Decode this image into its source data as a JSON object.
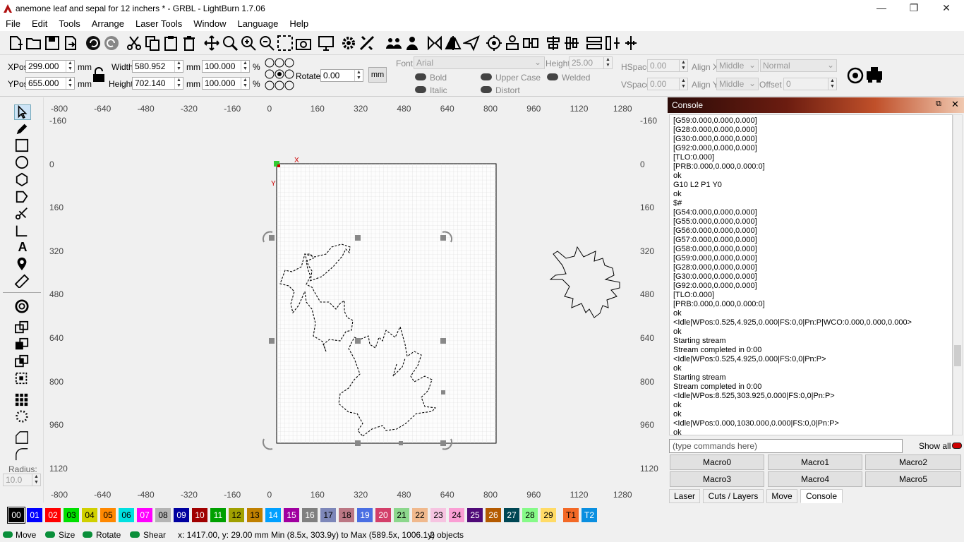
{
  "title": "anemone leaf and sepal for 12 inchers * - GRBL - LightBurn 1.7.06",
  "menu": [
    "File",
    "Edit",
    "Tools",
    "Arrange",
    "Laser Tools",
    "Window",
    "Language",
    "Help"
  ],
  "props": {
    "xpos_label": "XPos",
    "xpos": "299.000",
    "ypos_label": "YPos",
    "ypos": "655.000",
    "unit": "mm",
    "width_label": "Width",
    "width": "580.952",
    "height_label": "Height",
    "height": "702.140",
    "pct1": "100.000",
    "pct2": "100.000",
    "pct": "%",
    "rotate_label": "Rotate",
    "rotate": "0.00",
    "mm_button": "mm",
    "font_label": "Font",
    "font": "Arial",
    "fheight_label": "Height",
    "fheight": "25.00",
    "hspace_label": "HSpace",
    "hspace": "0.00",
    "vspace_label": "VSpace",
    "vspace": "0.00",
    "alignx_label": "Align X",
    "alignx": "Middle",
    "aligny_label": "Align Y",
    "aligny": "Middle",
    "normal": "Normal",
    "offset_label": "Offset",
    "offset": "0",
    "bold": "Bold",
    "italic": "Italic",
    "upper": "Upper Case",
    "distort": "Distort",
    "welded": "Welded"
  },
  "ruler": {
    "top": [
      "-800",
      "-640",
      "-480",
      "-320",
      "-160",
      "0",
      "160",
      "320",
      "480",
      "640",
      "800",
      "960",
      "1120",
      "1280"
    ],
    "left": [
      "-160",
      "0",
      "160",
      "320",
      "480",
      "640",
      "800",
      "960",
      "1120"
    ],
    "right": [
      "-160",
      "0",
      "160",
      "320",
      "480",
      "640",
      "800",
      "960",
      "1120"
    ]
  },
  "canvas": {
    "x_marker": "X",
    "y_marker": "Y"
  },
  "left_tools": {
    "radius_label": "Radius:",
    "radius": "10.0"
  },
  "console": {
    "title": "Console",
    "lines": [
      "[G59:0.000,0.000,0.000]",
      "[G28:0.000,0.000,0.000]",
      "[G30:0.000,0.000,0.000]",
      "[G92:0.000,0.000,0.000]",
      "[TLO:0.000]",
      "[PRB:0.000,0.000,0.000:0]",
      "ok",
      "G10 L2 P1 Y0",
      "ok",
      "$#",
      "[G54:0.000,0.000,0.000]",
      "[G55:0.000,0.000,0.000]",
      "[G56:0.000,0.000,0.000]",
      "[G57:0.000,0.000,0.000]",
      "[G58:0.000,0.000,0.000]",
      "[G59:0.000,0.000,0.000]",
      "[G28:0.000,0.000,0.000]",
      "[G30:0.000,0.000,0.000]",
      "[G92:0.000,0.000,0.000]",
      "[TLO:0.000]",
      "[PRB:0.000,0.000,0.000:0]",
      "ok",
      "<Idle|WPos:0.525,4.925,0.000|FS:0,0|Pn:P|WCO:0.000,0.000,0.000>",
      "ok",
      "Starting stream",
      "Stream completed in 0:00",
      "<Idle|WPos:0.525,4.925,0.000|FS:0,0|Pn:P>",
      "ok",
      "Starting stream",
      "Stream completed in 0:00",
      "<Idle|WPos:8.525,303.925,0.000|FS:0,0|Pn:P>",
      "ok",
      "ok",
      "<Idle|WPos:0.000,1030.000,0.000|FS:0,0|Pn:P>",
      "ok"
    ],
    "input_placeholder": "(type commands here)",
    "show_all": "Show all",
    "macros": [
      "Macro0",
      "Macro1",
      "Macro2",
      "Macro3",
      "Macro4",
      "Macro5"
    ],
    "tabs": [
      "Laser",
      "Cuts / Layers",
      "Move",
      "Console"
    ]
  },
  "palette": [
    {
      "n": "00",
      "c": "#000000",
      "t": "#ffffff"
    },
    {
      "n": "01",
      "c": "#0000ff",
      "t": "#ffffff"
    },
    {
      "n": "02",
      "c": "#ff0000",
      "t": "#ffffff"
    },
    {
      "n": "03",
      "c": "#00e000",
      "t": "#000000"
    },
    {
      "n": "04",
      "c": "#d0d000",
      "t": "#000000"
    },
    {
      "n": "05",
      "c": "#ff8800",
      "t": "#000000"
    },
    {
      "n": "06",
      "c": "#00e0e0",
      "t": "#000000"
    },
    {
      "n": "07",
      "c": "#ff00ff",
      "t": "#ffffff"
    },
    {
      "n": "08",
      "c": "#b4b4b4",
      "t": "#000000"
    },
    {
      "n": "09",
      "c": "#0000a0",
      "t": "#ffffff"
    },
    {
      "n": "10",
      "c": "#a00000",
      "t": "#ffffff"
    },
    {
      "n": "11",
      "c": "#00a000",
      "t": "#ffffff"
    },
    {
      "n": "12",
      "c": "#a0a000",
      "t": "#000000"
    },
    {
      "n": "13",
      "c": "#c08000",
      "t": "#000000"
    },
    {
      "n": "14",
      "c": "#00a0ff",
      "t": "#ffffff"
    },
    {
      "n": "15",
      "c": "#a000a0",
      "t": "#ffffff"
    },
    {
      "n": "16",
      "c": "#808080",
      "t": "#ffffff"
    },
    {
      "n": "17",
      "c": "#7d87b9",
      "t": "#000000"
    },
    {
      "n": "18",
      "c": "#bb7784",
      "t": "#000000"
    },
    {
      "n": "19",
      "c": "#4a6fe3",
      "t": "#ffffff"
    },
    {
      "n": "20",
      "c": "#d33f6a",
      "t": "#ffffff"
    },
    {
      "n": "21",
      "c": "#8cd78c",
      "t": "#000000"
    },
    {
      "n": "22",
      "c": "#f0b98d",
      "t": "#000000"
    },
    {
      "n": "23",
      "c": "#f6c4e1",
      "t": "#000000"
    },
    {
      "n": "24",
      "c": "#fa9ed4",
      "t": "#000000"
    },
    {
      "n": "25",
      "c": "#500a78",
      "t": "#ffffff"
    },
    {
      "n": "26",
      "c": "#b45a00",
      "t": "#ffffff"
    },
    {
      "n": "27",
      "c": "#004754",
      "t": "#ffffff"
    },
    {
      "n": "28",
      "c": "#86fa88",
      "t": "#000000"
    },
    {
      "n": "29",
      "c": "#ffdb66",
      "t": "#000000"
    },
    {
      "n": "T1",
      "c": "#f36926",
      "t": "#000000"
    },
    {
      "n": "T2",
      "c": "#0a8fe0",
      "t": "#ffffff"
    }
  ],
  "status": {
    "move": "Move",
    "size": "Size",
    "rotate": "Rotate",
    "shear": "Shear",
    "coords": "x: 1417.00, y: 29.00 mm",
    "range": "Min (8.5x, 303.9y) to Max (589.5x, 1006.1y)",
    "objects": "2 objects"
  }
}
